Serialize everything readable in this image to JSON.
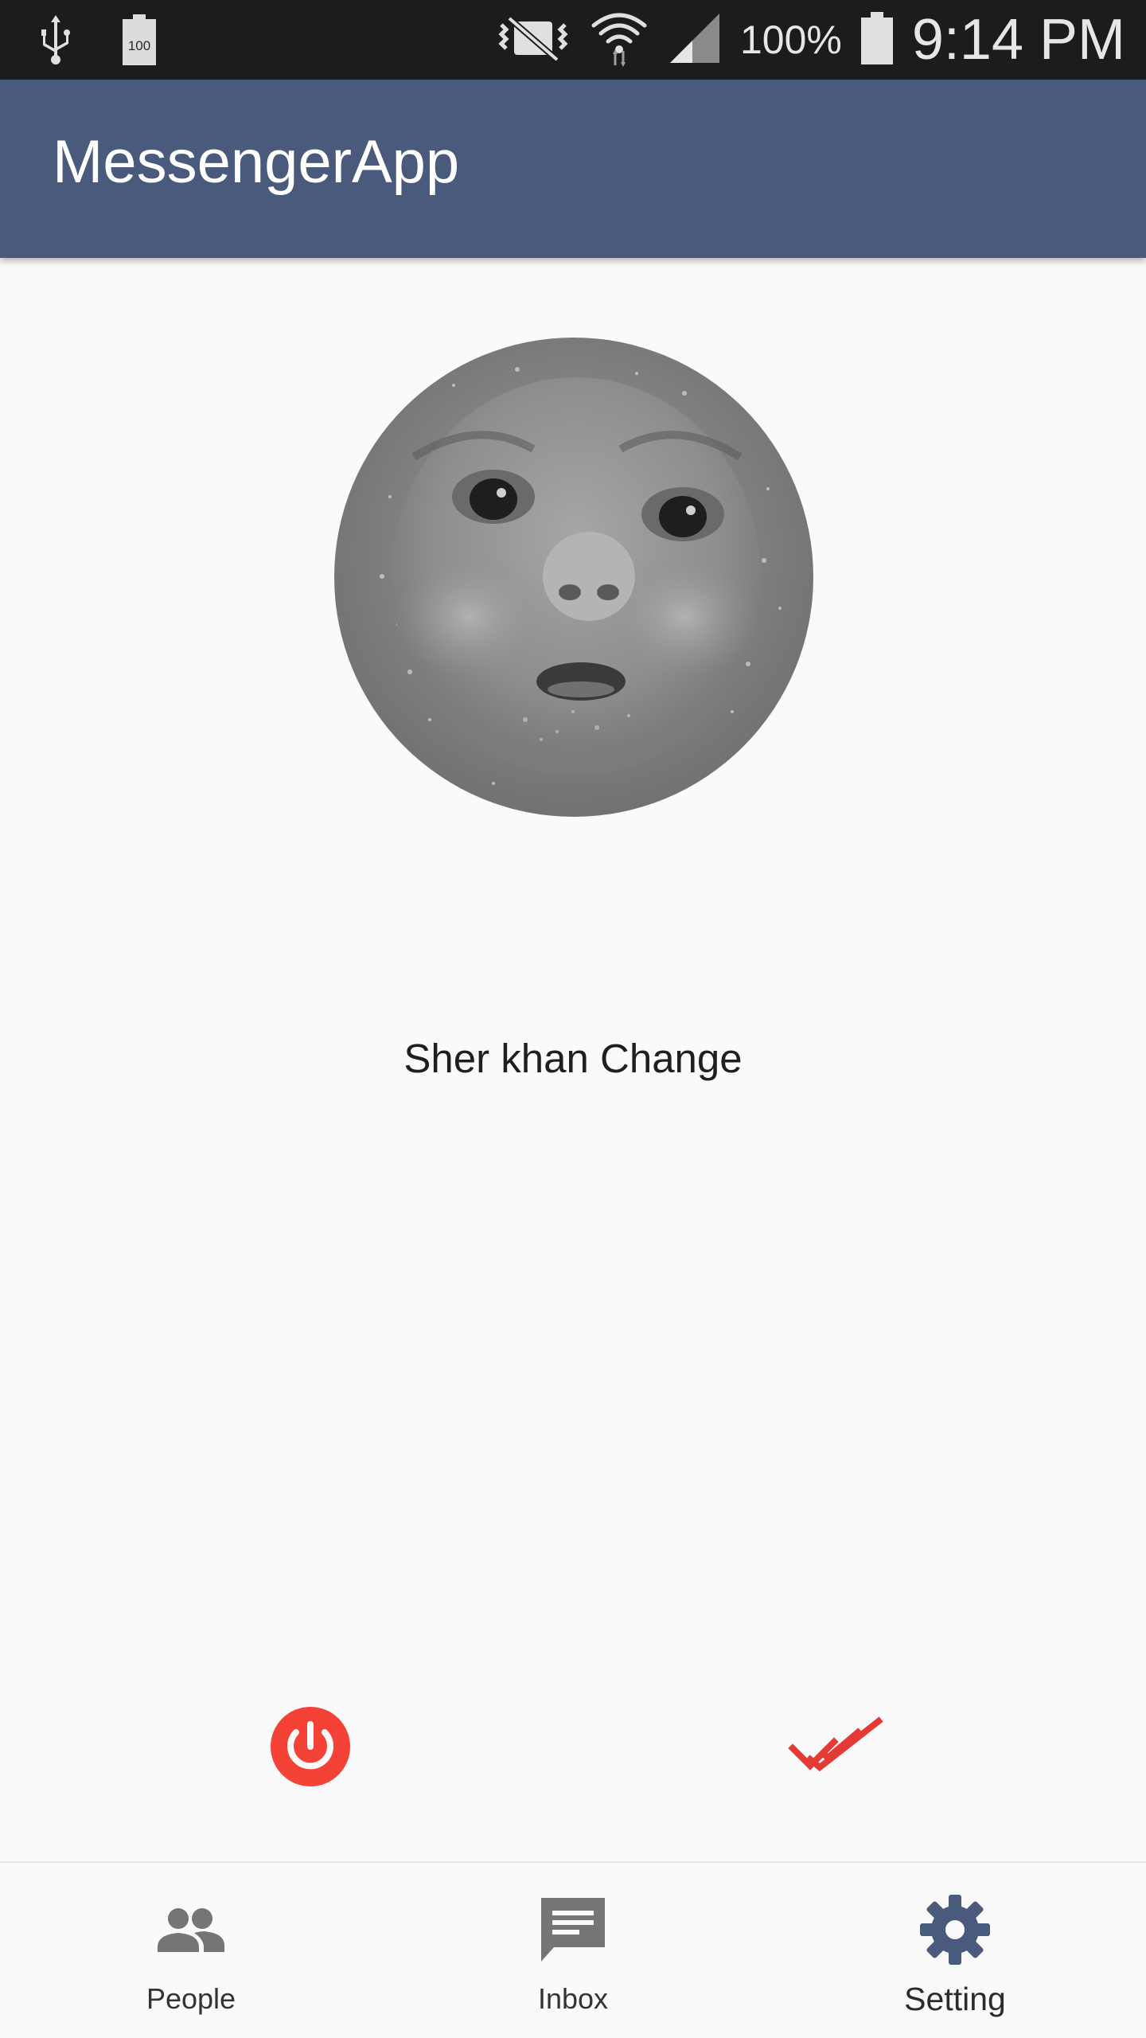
{
  "status_bar": {
    "battery_percent": "100%",
    "battery_icon_text": "100",
    "time": "9:14 PM"
  },
  "app_bar": {
    "title": "MessengerApp",
    "color": "#4a5a7c"
  },
  "profile": {
    "avatar_icon": "profile-photo",
    "name": "Sher khan Change"
  },
  "actions": {
    "power_icon": "power-icon",
    "power_color": "#f44336",
    "check_icon": "double-check-icon",
    "check_color": "#e53935"
  },
  "bottom_nav": {
    "items": [
      {
        "label": "People",
        "icon": "people-icon",
        "active": false
      },
      {
        "label": "Inbox",
        "icon": "chat-icon",
        "active": false
      },
      {
        "label": "Setting",
        "icon": "gear-icon",
        "active": true
      }
    ],
    "active_color": "#4a5a7c",
    "inactive_color": "#757575"
  }
}
